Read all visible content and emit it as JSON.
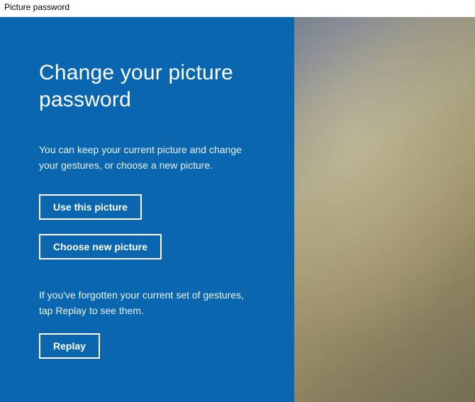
{
  "window": {
    "title": "Picture password"
  },
  "panel": {
    "heading": "Change your picture password",
    "description1": "You can keep your current picture and change your gestures, or choose a new picture.",
    "description2": "If you've forgotten your current set of gestures, tap Replay to see them.",
    "buttons": {
      "use_this_picture": "Use this picture",
      "choose_new_picture": "Choose new picture",
      "replay": "Replay"
    }
  }
}
